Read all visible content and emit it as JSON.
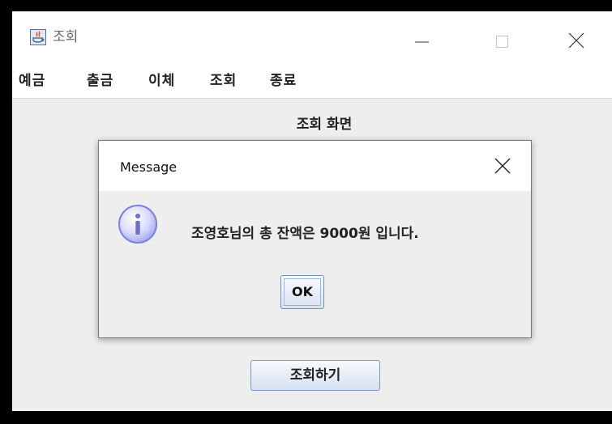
{
  "window": {
    "title": "조회"
  },
  "menubar": {
    "items": [
      {
        "label": "예금"
      },
      {
        "label": "출금"
      },
      {
        "label": "이체"
      },
      {
        "label": "조회"
      },
      {
        "label": "종료"
      }
    ]
  },
  "content": {
    "title": "조회 화면",
    "button_label": "조회하기"
  },
  "dialog": {
    "title": "Message",
    "message": "조영호님의 총 잔액은 9000원 입니다.",
    "ok_label": "OK",
    "icon": "info-icon"
  },
  "colors": {
    "background": "#eeeeee",
    "titlebar": "#ffffff",
    "button_border": "#7a9cc4",
    "info_icon": "#9aa0ef"
  }
}
